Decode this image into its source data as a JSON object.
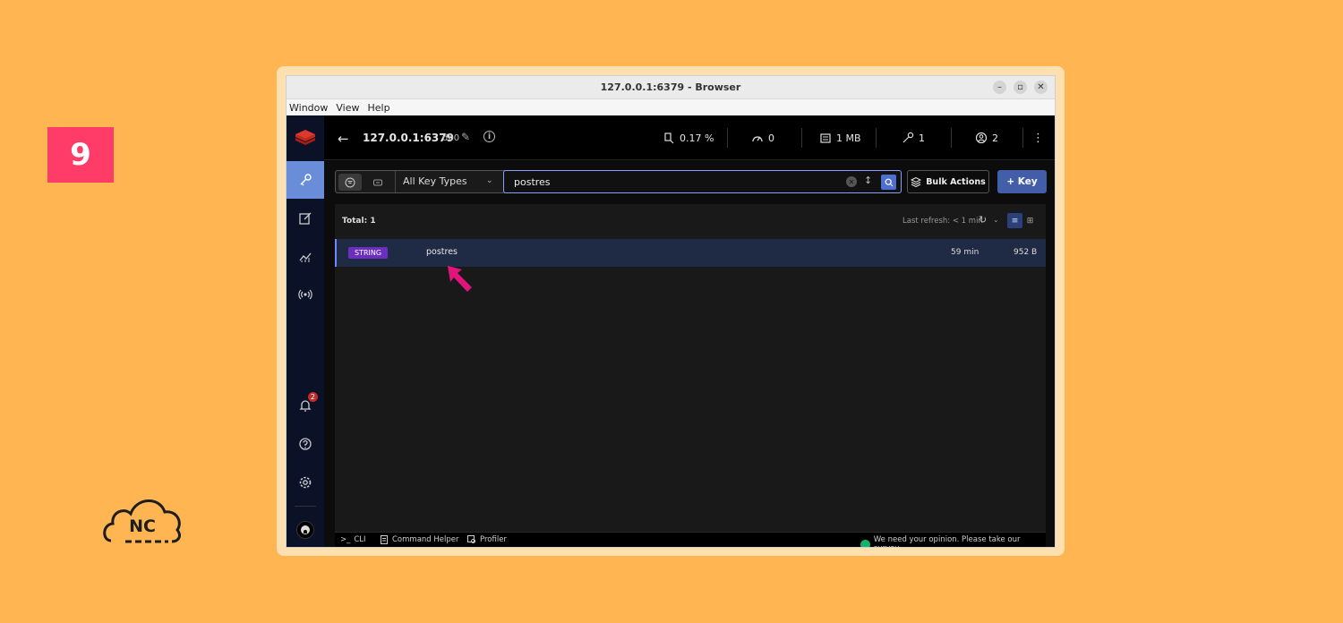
{
  "step": "9",
  "logo_text": "NC",
  "window": {
    "title": "127.0.0.1:6379 - Browser",
    "controls": {
      "minimize": "–",
      "restore": "▫",
      "close": "✕"
    }
  },
  "menu": {
    "items": [
      {
        "label": "Window"
      },
      {
        "label": "View"
      },
      {
        "label": "Help"
      }
    ]
  },
  "topbar": {
    "back": "←",
    "host": "127.0.0.1:6379",
    "db": "db0",
    "edit": "✎",
    "info": "i",
    "stats": {
      "cpu": "0.17 %",
      "ops": "0",
      "memory": "1 MB",
      "keys": "1",
      "clients": "2"
    },
    "more": "⋮"
  },
  "sidebar": {
    "notifications_count": "2"
  },
  "search": {
    "key_type": "All Key Types",
    "key_type_chevron": "⌄",
    "value": "postres",
    "clear": "✕",
    "sort": "↕",
    "bulk_actions": "Bulk Actions",
    "add_key": "+ Key"
  },
  "list": {
    "total": "Total: 1",
    "last_refresh": "Last refresh: < 1 min",
    "refresh_icon": "↻",
    "refresh_chevron": "⌄",
    "view_list": "≡",
    "view_tree": "⊞",
    "rows": [
      {
        "type": "STRING",
        "name": "postres",
        "ttl": "59 min",
        "size": "952 B"
      }
    ]
  },
  "statusbar": {
    "cli": "CLI",
    "cli_icon": ">_",
    "command_helper": "Command Helper",
    "profiler": "Profiler",
    "survey": "We need your opinion. Please take our survey."
  },
  "colors": {
    "background": "#ffb652",
    "step_badge": "#ff3b67",
    "active_nav": "#6a8dd9",
    "primary_button": "#435ea8",
    "type_badge": "#6a2fbf",
    "pointer": "#e0157a"
  }
}
